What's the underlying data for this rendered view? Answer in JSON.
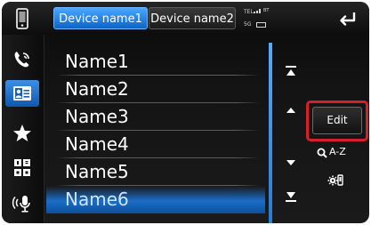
{
  "header": {
    "tabs": [
      {
        "label": "Device name1",
        "active": true
      },
      {
        "label": "Device name2",
        "active": false
      }
    ],
    "status": {
      "line1": "TEL",
      "line2": "BT",
      "line3": "5G"
    }
  },
  "contacts": {
    "names": [
      "Name1",
      "Name2",
      "Name3",
      "Name4",
      "Name5",
      "Name6"
    ],
    "selected_index": 5
  },
  "controls": {
    "edit_label": "Edit",
    "search_label": "A-Z"
  },
  "sidebar": {
    "items": [
      "phone-icon",
      "phonebook-icon",
      "favorites-icon",
      "keypad-icon",
      "voice-recognition-icon"
    ],
    "active_item": "phonebook-icon"
  },
  "colors": {
    "accent_blue": "#1b6ec8",
    "highlight_red": "#d5202c",
    "background": "#111111",
    "text": "#ffffff"
  }
}
